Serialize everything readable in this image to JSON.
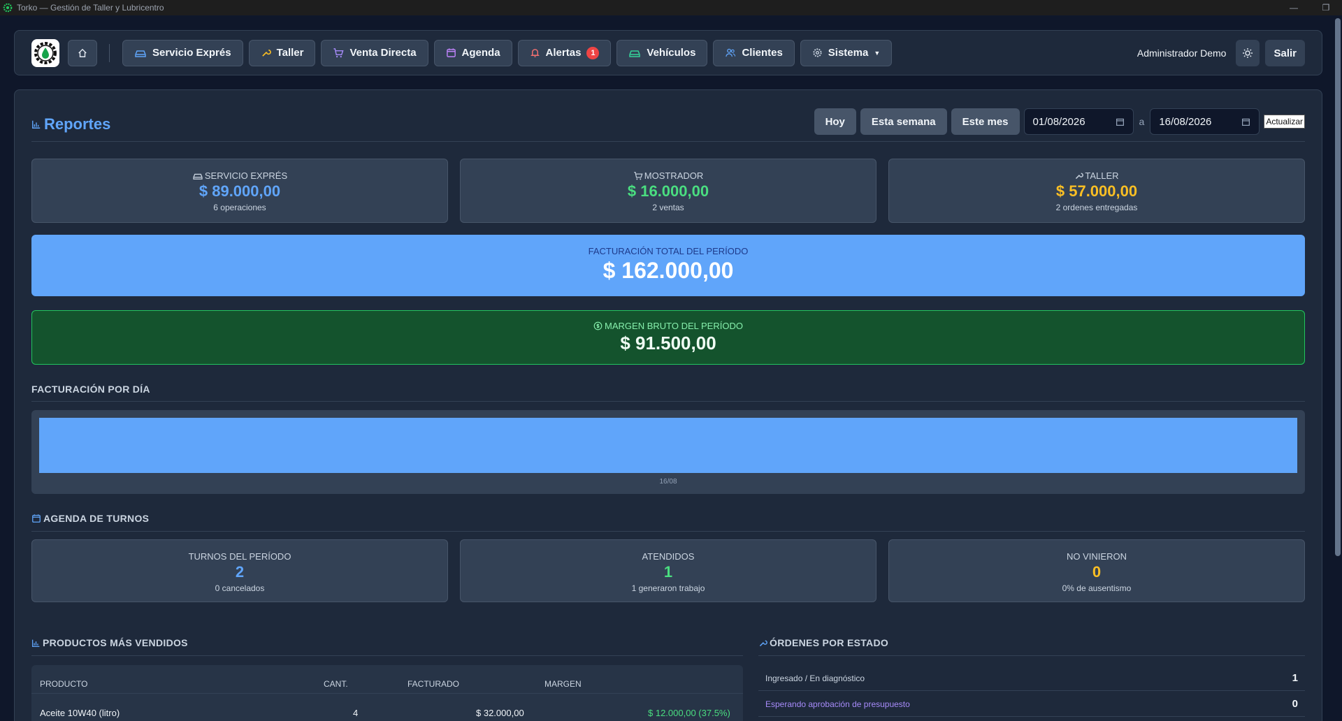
{
  "window": {
    "title": "Torko — Gestión de Taller y Lubricentro",
    "controls": [
      "minimize-icon",
      "restore-icon"
    ]
  },
  "navbar": {
    "items": [
      {
        "label": "Servicio Exprés",
        "icon": "car-icon"
      },
      {
        "label": "Taller",
        "icon": "wrench-icon"
      },
      {
        "label": "Venta Directa",
        "icon": "cart-icon"
      },
      {
        "label": "Agenda",
        "icon": "calendar-icon"
      },
      {
        "label": "Alertas",
        "icon": "bell-icon",
        "badge": "1"
      },
      {
        "label": "Vehículos",
        "icon": "car-icon"
      },
      {
        "label": "Clientes",
        "icon": "users-icon"
      },
      {
        "label": "Sistema",
        "icon": "gear-icon"
      }
    ],
    "user": "Administrador Demo",
    "logout_label": "Salir"
  },
  "reportes": {
    "title": "Reportes",
    "filters": {
      "today": "Hoy",
      "week": "Esta semana",
      "month": "Este mes",
      "date_from": "01/08/2026",
      "separator": "a",
      "date_to": "16/08/2026",
      "update": "Actualizar"
    }
  },
  "stats": {
    "express": {
      "label": "Servicio Exprés",
      "value": "$ 89.000,00",
      "sub": "6 operaciones",
      "color": "#60a5fa"
    },
    "mostrador": {
      "label": "Mostrador",
      "value": "$ 16.000,00",
      "sub": "2 ventas",
      "color": "#4ade80"
    },
    "taller": {
      "label": "Taller",
      "value": "$ 57.000,00",
      "sub": "2 ordenes entregadas",
      "color": "#fbbf24"
    }
  },
  "total": {
    "label": "FACTURACIÓN TOTAL DEL PERÍODO",
    "value": "$ 162.000,00"
  },
  "margin": {
    "label": "MARGEN BRUTO DEL PERÍODO",
    "value": "$ 91.500,00"
  },
  "daily": {
    "title": "FACTURACIÓN POR DÍA"
  },
  "chart_data": {
    "type": "bar",
    "categories": [
      "16/08"
    ],
    "values": [
      162000
    ],
    "color": "#60a5fa"
  },
  "agenda": {
    "title": "AGENDA DE TURNOS",
    "cards": [
      {
        "label": "TURNOS DEL PERÍODO",
        "value": "2",
        "sub": "0 cancelados",
        "color": "#60a5fa"
      },
      {
        "label": "ATENDIDOS",
        "value": "1",
        "sub": "1 generaron trabajo",
        "color": "#4ade80"
      },
      {
        "label": "NO VINIERON",
        "value": "0",
        "sub": "0% de ausentismo",
        "color": "#fbbf24"
      }
    ]
  },
  "productos": {
    "title": "PRODUCTOS MÁS VENDIDOS",
    "columns": [
      "PRODUCTO",
      "CANT.",
      "FACTURADO",
      "MARGEN"
    ],
    "rows": [
      {
        "producto": "Aceite 10W40 (litro)",
        "cant": "4",
        "facturado": "$ 32.000,00",
        "margen": "$ 12.000,00 (37.5%)"
      }
    ]
  },
  "ordenes": {
    "title": "ÓRDENES POR ESTADO",
    "rows": [
      {
        "estado": "Ingresado / En diagnóstico",
        "count": "1",
        "color": "#cbd5e1"
      },
      {
        "estado": "Esperando aprobación de presupuesto",
        "count": "0",
        "color": "#a78bfa"
      }
    ]
  }
}
